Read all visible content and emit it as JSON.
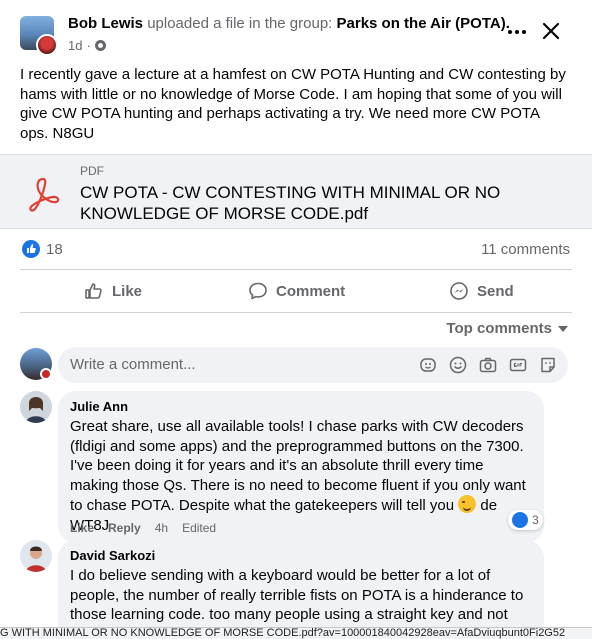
{
  "post": {
    "author": "Bob Lewis",
    "action_text": "uploaded a file in the group:",
    "group": "Parks on the Air (POTA).",
    "time": "1d",
    "dot": "·",
    "more_icon": "more-horizontal-icon",
    "close_icon": "close-icon",
    "body": "I recently gave a lecture at a hamfest on CW POTA Hunting and CW contesting by hams with little or no knowledge of Morse Code.  I am hoping that some of you will give CW POTA hunting and perhaps activating a try.  We need more CW POTA ops.  N8GU"
  },
  "attachment": {
    "type": "PDF",
    "title": "CW POTA - CW CONTESTING WITH MINIMAL OR NO KNOWLEDGE OF MORSE CODE.pdf",
    "icon": "pdf-icon"
  },
  "stats": {
    "reactions": "18",
    "comments": "11 comments"
  },
  "actions": {
    "like": "Like",
    "comment": "Comment",
    "send": "Send"
  },
  "sort": {
    "label": "Top comments"
  },
  "composer": {
    "placeholder": "Write a comment...",
    "icons": [
      "avatar-sticker-icon",
      "emoji-icon",
      "camera-icon",
      "gif-icon",
      "sticker-icon"
    ]
  },
  "comments": [
    {
      "name": "Julie Ann",
      "text_before_emoji": "Great share, use all available tools! I chase parks with CW decoders (fldigi and some apps) and the preprogrammed buttons on the 7300. I've been doing it for years and it's an absolute thrill every time making those Qs. There is no need to become fluent if you only want to chase POTA. Despite what the gatekeepers will tell you ",
      "text_after_emoji": " de WT8J",
      "like": "Like",
      "reply": "Reply",
      "time": "4h",
      "edited": "Edited",
      "reactions": "3"
    },
    {
      "name": "David Sarkozi",
      "text": "I do believe sending with a keyboard would be better for a lot of people, the number of really terrible fists on POTA is a hinderance to those learning code. too many people using a straight key and not"
    }
  ],
  "status_bar": {
    "url": "G WITH MINIMAL OR NO KNOWLEDGE OF MORSE CODE.pdf?av=100001840042928eav=AfaDviuqbunt0Fi2G52"
  },
  "colors": {
    "accent": "#1b74e4",
    "muted": "#65676b",
    "bubble": "#f0f2f5",
    "pdf_red": "#e34034"
  }
}
